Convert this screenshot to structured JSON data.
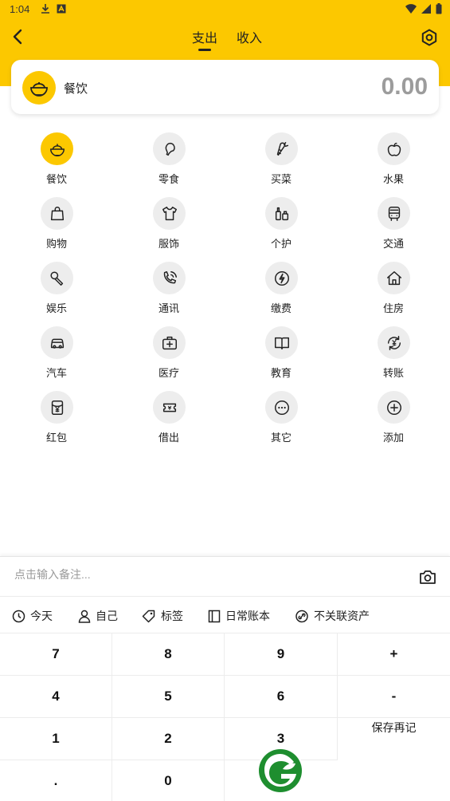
{
  "status": {
    "time": "1:04"
  },
  "tabs": {
    "expense": "支出",
    "income": "收入"
  },
  "selected": {
    "label": "餐饮",
    "amount": "0.00",
    "icon": "rice-bowl-icon"
  },
  "categories": [
    {
      "label": "餐饮",
      "icon": "rice-bowl-icon"
    },
    {
      "label": "零食",
      "icon": "chicken-leg-icon"
    },
    {
      "label": "买菜",
      "icon": "carrot-icon"
    },
    {
      "label": "水果",
      "icon": "apple-icon"
    },
    {
      "label": "购物",
      "icon": "shopping-bag-icon"
    },
    {
      "label": "服饰",
      "icon": "shirt-icon"
    },
    {
      "label": "个护",
      "icon": "bottles-icon"
    },
    {
      "label": "交通",
      "icon": "bus-icon"
    },
    {
      "label": "娱乐",
      "icon": "microphone-icon"
    },
    {
      "label": "通讯",
      "icon": "phone-icon"
    },
    {
      "label": "缴费",
      "icon": "lightning-icon"
    },
    {
      "label": "住房",
      "icon": "house-icon"
    },
    {
      "label": "汽车",
      "icon": "car-icon"
    },
    {
      "label": "医疗",
      "icon": "medical-kit-icon"
    },
    {
      "label": "教育",
      "icon": "book-icon"
    },
    {
      "label": "转账",
      "icon": "yuan-transfer-icon"
    },
    {
      "label": "红包",
      "icon": "red-envelope-icon"
    },
    {
      "label": "借出",
      "icon": "loan-ticket-icon"
    },
    {
      "label": "其它",
      "icon": "more-dots-icon"
    },
    {
      "label": "添加",
      "icon": "plus-circle-icon"
    }
  ],
  "note": {
    "placeholder": "点击输入备注..."
  },
  "options": {
    "date": "今天",
    "member": "自己",
    "tag": "标签",
    "book": "日常账本",
    "asset": "不关联资产"
  },
  "keypad": {
    "k7": "7",
    "k8": "8",
    "k9": "9",
    "plus": "+",
    "k4": "4",
    "k5": "5",
    "k6": "6",
    "minus": "-",
    "k1": "1",
    "k2": "2",
    "k3": "3",
    "save_again": "保存再记",
    "dot": ".",
    "k0": "0"
  },
  "colors": {
    "accent": "#fcc800",
    "icon_bg": "#ededed",
    "amount": "#9c9c9c"
  }
}
